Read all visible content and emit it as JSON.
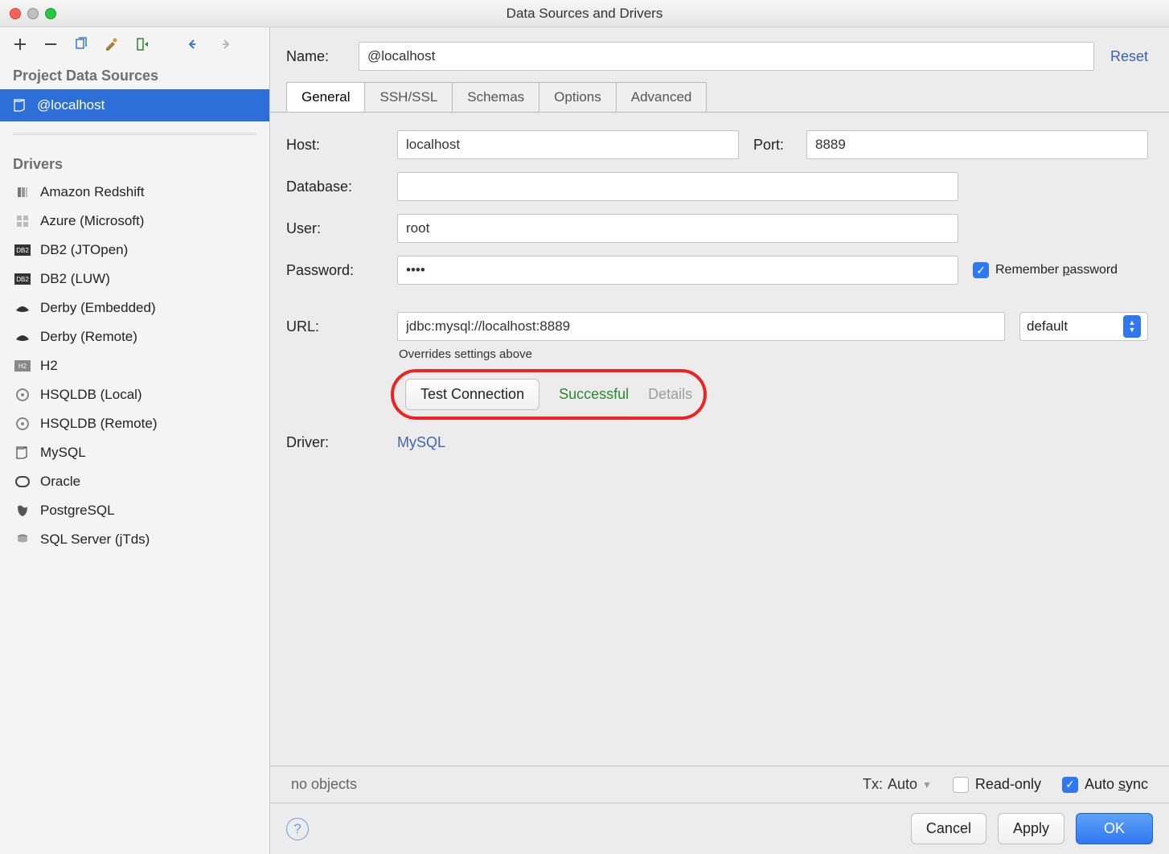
{
  "window": {
    "title": "Data Sources and Drivers"
  },
  "sidebar": {
    "section1": "Project Data Sources",
    "selected_source": "@localhost",
    "section2": "Drivers",
    "drivers": [
      "Amazon Redshift",
      "Azure (Microsoft)",
      "DB2 (JTOpen)",
      "DB2 (LUW)",
      "Derby (Embedded)",
      "Derby (Remote)",
      "H2",
      "HSQLDB (Local)",
      "HSQLDB (Remote)",
      "MySQL",
      "Oracle",
      "PostgreSQL",
      "SQL Server (jTds)"
    ]
  },
  "form": {
    "name_label": "Name:",
    "name_value": "@localhost",
    "reset": "Reset",
    "tabs": [
      "General",
      "SSH/SSL",
      "Schemas",
      "Options",
      "Advanced"
    ],
    "active_tab": "General",
    "host_label": "Host:",
    "host_value": "localhost",
    "port_label": "Port:",
    "port_value": "8889",
    "db_label": "Database:",
    "db_value": "",
    "user_label": "User:",
    "user_value": "root",
    "pw_label": "Password:",
    "pw_value": "••••",
    "remember_pre": "Remember ",
    "remember_u": "p",
    "remember_post": "assword",
    "url_label": "URL:",
    "url_value": "jdbc:mysql://localhost:8889",
    "url_mode": "default",
    "url_hint": "Overrides settings above",
    "test_btn": "Test Connection",
    "success": "Successful",
    "details": "Details",
    "driver_label": "Driver:",
    "driver_link": "MySQL"
  },
  "status": {
    "noobj": "no objects",
    "tx_label": "Tx:",
    "tx_value": "Auto",
    "readonly": "Read-only",
    "autosync_pre": "Auto ",
    "autosync_u": "s",
    "autosync_post": "ync"
  },
  "footer": {
    "cancel": "Cancel",
    "apply": "Apply",
    "ok": "OK"
  }
}
